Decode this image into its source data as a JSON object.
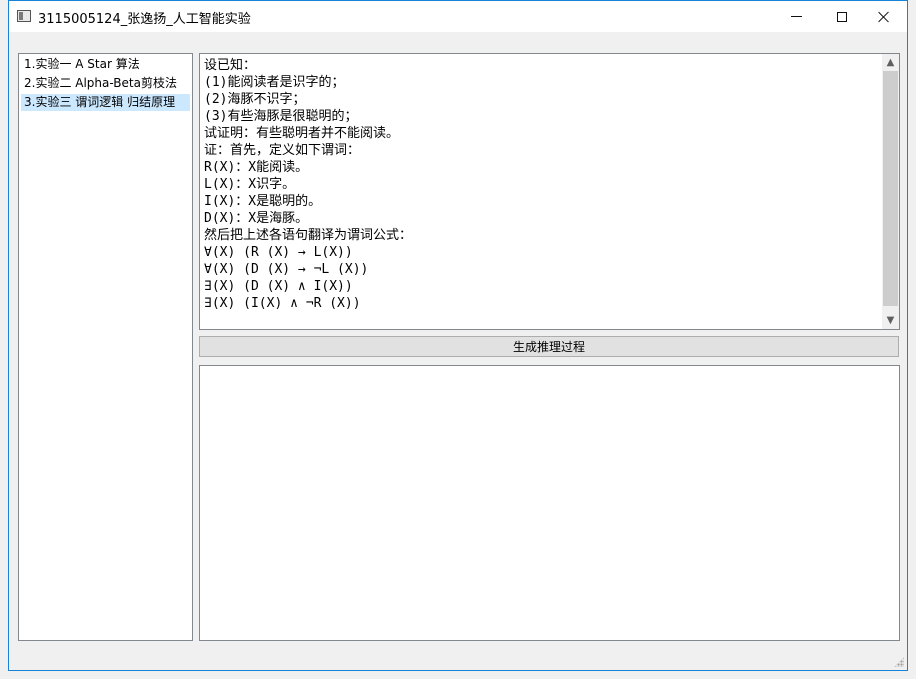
{
  "window": {
    "title": "3115005124_张逸扬_人工智能实验"
  },
  "sidebar": {
    "items": [
      {
        "label": "1.实验一  A Star 算法",
        "selected": false
      },
      {
        "label": "2.实验二  Alpha-Beta剪枝法",
        "selected": false
      },
      {
        "label": "3.实验三  谓词逻辑 归结原理",
        "selected": true
      }
    ]
  },
  "problem": {
    "lines": [
      "设已知：",
      "(1)能阅读者是识字的；",
      "(2)海豚不识字；",
      "(3)有些海豚是很聪明的；",
      "试证明：有些聪明者并不能阅读。",
      "证：首先，定义如下谓词：",
      "R(X)：X能阅读。",
      "L(X)：X识字。",
      "I(X)：X是聪明的。",
      "D(X)：X是海豚。",
      "然后把上述各语句翻译为谓词公式：",
      "∀(X) (R (X) → L(X))",
      "∀(X) (D (X) → ¬L (X))",
      "∃(X) (D (X) ∧ I(X))",
      "∃(X) (I(X) ∧ ¬R (X))"
    ]
  },
  "actions": {
    "generate_label": "生成推理过程"
  },
  "output": {
    "text": ""
  }
}
